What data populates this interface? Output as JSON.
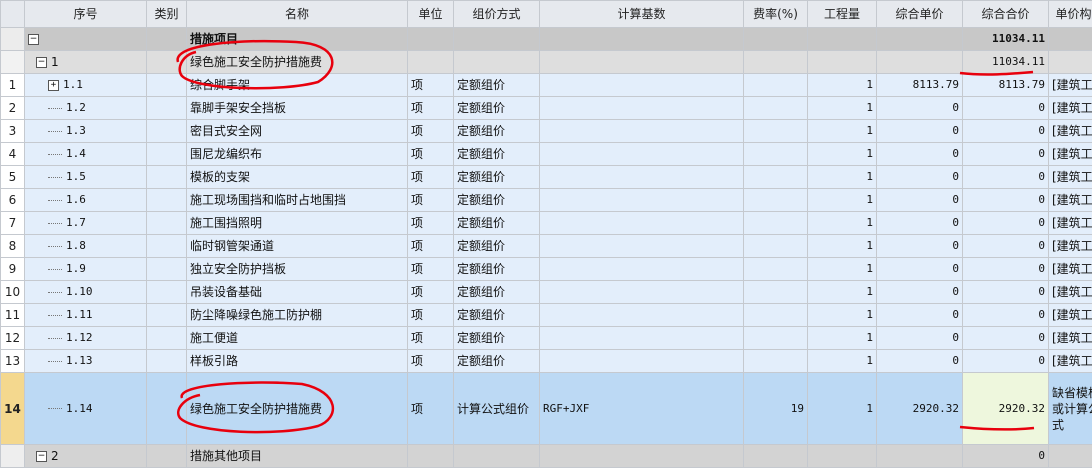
{
  "columns": {
    "index": "序号",
    "category": "类别",
    "name": "名称",
    "unit": "单位",
    "pricing": "组价方式",
    "base": "计算基数",
    "rate": "费率(%)",
    "quantity": "工程量",
    "unit_price": "综合单价",
    "total": "综合合价",
    "composition": "单价构成"
  },
  "group": {
    "expander": "−",
    "name": "措施项目",
    "total": "11034.11"
  },
  "sub": {
    "expander": "−",
    "index": "1",
    "name": "绿色施工安全防护措施费",
    "total": "11034.11"
  },
  "rows": [
    {
      "rn": "1",
      "index": "1.1",
      "expander": "+",
      "name": "综合脚手架",
      "unit": "项",
      "pricing": "定额组价",
      "quantity": "1",
      "unit_price": "8113.79",
      "total": "8113.79",
      "composition": "[建筑工程("
    },
    {
      "rn": "2",
      "index": "1.2",
      "name": "靠脚手架安全挡板",
      "unit": "项",
      "pricing": "定额组价",
      "quantity": "1",
      "unit_price": "0",
      "total": "0",
      "composition": "[建筑工程("
    },
    {
      "rn": "3",
      "index": "1.3",
      "name": "密目式安全网",
      "unit": "项",
      "pricing": "定额组价",
      "quantity": "1",
      "unit_price": "0",
      "total": "0",
      "composition": "[建筑工程("
    },
    {
      "rn": "4",
      "index": "1.4",
      "name": "围尼龙编织布",
      "unit": "项",
      "pricing": "定额组价",
      "quantity": "1",
      "unit_price": "0",
      "total": "0",
      "composition": "[建筑工程("
    },
    {
      "rn": "5",
      "index": "1.5",
      "name": "模板的支架",
      "unit": "项",
      "pricing": "定额组价",
      "quantity": "1",
      "unit_price": "0",
      "total": "0",
      "composition": "[建筑工程("
    },
    {
      "rn": "6",
      "index": "1.6",
      "name": "施工现场围挡和临时占地围挡",
      "unit": "项",
      "pricing": "定额组价",
      "quantity": "1",
      "unit_price": "0",
      "total": "0",
      "composition": "[建筑工程("
    },
    {
      "rn": "7",
      "index": "1.7",
      "name": "施工围挡照明",
      "unit": "项",
      "pricing": "定额组价",
      "quantity": "1",
      "unit_price": "0",
      "total": "0",
      "composition": "[建筑工程("
    },
    {
      "rn": "8",
      "index": "1.8",
      "name": "临时钢管架通道",
      "unit": "项",
      "pricing": "定额组价",
      "quantity": "1",
      "unit_price": "0",
      "total": "0",
      "composition": "[建筑工程("
    },
    {
      "rn": "9",
      "index": "1.9",
      "name": "独立安全防护挡板",
      "unit": "项",
      "pricing": "定额组价",
      "quantity": "1",
      "unit_price": "0",
      "total": "0",
      "composition": "[建筑工程("
    },
    {
      "rn": "10",
      "index": "1.10",
      "name": "吊装设备基础",
      "unit": "项",
      "pricing": "定额组价",
      "quantity": "1",
      "unit_price": "0",
      "total": "0",
      "composition": "[建筑工程("
    },
    {
      "rn": "11",
      "index": "1.11",
      "name": "防尘降噪绿色施工防护棚",
      "unit": "项",
      "pricing": "定额组价",
      "quantity": "1",
      "unit_price": "0",
      "total": "0",
      "composition": "[建筑工程("
    },
    {
      "rn": "12",
      "index": "1.12",
      "name": "施工便道",
      "unit": "项",
      "pricing": "定额组价",
      "quantity": "1",
      "unit_price": "0",
      "total": "0",
      "composition": "[建筑工程("
    },
    {
      "rn": "13",
      "index": "1.13",
      "name": "样板引路",
      "unit": "项",
      "pricing": "定额组价",
      "quantity": "1",
      "unit_price": "0",
      "total": "0",
      "composition": "[建筑工程("
    }
  ],
  "selected": {
    "rn": "14",
    "index": "1.14",
    "name": "绿色施工安全防护措施费",
    "unit": "项",
    "pricing": "计算公式组价",
    "base": "RGF+JXF",
    "rate": "19",
    "quantity": "1",
    "unit_price": "2920.32",
    "total": "2920.32",
    "composition_1": "缺省模板(",
    "composition_2": "或计算公式"
  },
  "bottom": {
    "expander": "−",
    "index": "2",
    "name": "措施其他项目",
    "total": "0"
  },
  "annotation_color": "#e8000d"
}
